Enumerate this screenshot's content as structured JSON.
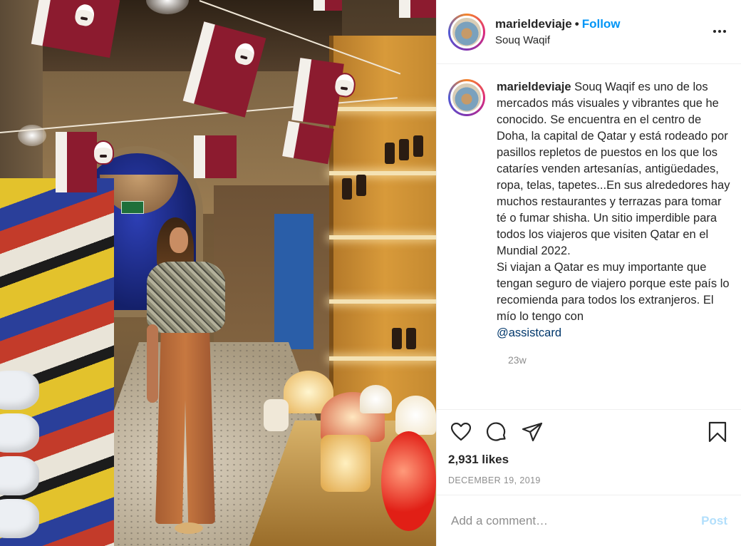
{
  "header": {
    "username": "marieldeviaje",
    "separator": "•",
    "follow_label": "Follow",
    "location": "Souq Waqif"
  },
  "icons": {
    "more": "more-horizontal-icon",
    "like": "heart-icon",
    "comment": "comment-bubble-icon",
    "share": "paper-plane-icon",
    "save": "bookmark-icon"
  },
  "caption": {
    "username": "marieldeviaje",
    "text": "Souq Waqif es uno de los mercados más visuales y vibrantes que he conocido. Se encuentra en el centro de Doha, la capital de Qatar y está rodeado por pasillos repletos de puestos en los que los cataríes venden artesanías, antigüedades, ropa, telas, tapetes...En sus alrededores hay muchos restaurantes y terrazas para tomar té o fumar shisha. Un sitio imperdible para todos los viajeros que visiten Qatar en el Mundial 2022.",
    "text2": "Si viajan a Qatar es muy importante que tengan seguro de viajero porque este país lo recomienda para todos los extranjeros. El mío lo tengo con",
    "mention": "@assistcard",
    "time": "23w"
  },
  "stats": {
    "likes": "2,931 likes",
    "date": "DECEMBER 19, 2019"
  },
  "comment_box": {
    "placeholder": "Add a comment…",
    "post_label": "Post"
  },
  "colors": {
    "accent": "#0095f6",
    "post_disabled": "#b2dffc",
    "muted": "#8e8e8e",
    "flag": "#8c1b2f"
  }
}
